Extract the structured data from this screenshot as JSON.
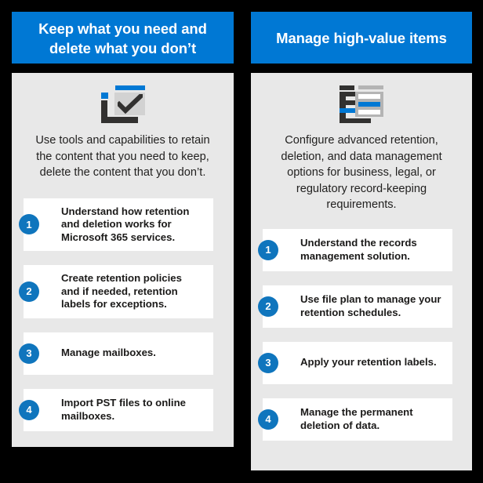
{
  "theme": {
    "background": "#000000",
    "header_blue": "#0078d4",
    "panel_grey": "#e8e8e8",
    "card_white": "#ffffff",
    "badge_blue": "#0f75bd",
    "text_dark": "#201f1e"
  },
  "columns": [
    {
      "id": "keep-delete",
      "header": "Keep what you need and delete what you don’t",
      "icon": "checklist-icon",
      "intro": "Use tools and capabilities to retain the content that you need to keep, delete the content that you don’t.",
      "steps": [
        {
          "number": "1",
          "text": "Understand how retention and deletion works for Microsoft 365 services."
        },
        {
          "number": "2",
          "text": "Create retention policies and if needed, retention labels for exceptions."
        },
        {
          "number": "3",
          "text": "Manage mailboxes."
        },
        {
          "number": "4",
          "text": "Import PST files to online mailboxes."
        }
      ]
    },
    {
      "id": "high-value-items",
      "header": "Manage high-value items",
      "icon": "records-management-icon",
      "intro": "Configure advanced retention, deletion, and data management options for business, legal, or regulatory record-keeping requirements.",
      "steps": [
        {
          "number": "1",
          "text": "Understand the records management solution."
        },
        {
          "number": "2",
          "text": "Use file plan to manage your retention schedules."
        },
        {
          "number": "3",
          "text": "Apply your retention labels."
        },
        {
          "number": "4",
          "text": "Manage the permanent deletion of data."
        }
      ]
    }
  ]
}
